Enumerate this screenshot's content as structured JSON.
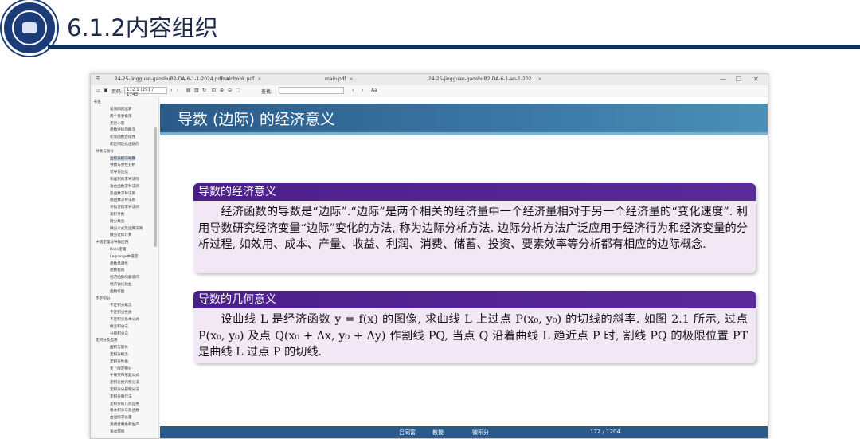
{
  "slide": {
    "title": "6.1.2内容组织"
  },
  "window": {
    "tabs": [
      {
        "label": "24-25-jingguan-gaoshuB2-DA-6-1-1-2024.pdf"
      },
      {
        "label": "mainbook.pdf"
      },
      {
        "label": "main.pdf"
      },
      {
        "label": "24-25-jingguan-gaoshuB2-DA-6-1-an-1-202.."
      }
    ],
    "controls": [
      "—",
      "☐",
      "✕"
    ],
    "toolbar": {
      "page_label": "页码:",
      "page_value": "172.1 (291 / 1743)",
      "search_label": "查找:",
      "aa": "Aa"
    }
  },
  "sidebar": {
    "title": "书签",
    "items": [
      {
        "label": "极限四则运算",
        "indent": 2
      },
      {
        "label": "两个重要极限",
        "indent": 2
      },
      {
        "label": "无穷小量",
        "indent": 2
      },
      {
        "label": "函数连续的概念",
        "indent": 2
      },
      {
        "label": "初等函数连续性",
        "indent": 2
      },
      {
        "label": "闭区间连续函数的",
        "indent": 2
      },
      {
        "label": "导数与微分",
        "indent": 1
      },
      {
        "label": "边际分析与导数",
        "indent": 2
      },
      {
        "label": "导数与弹性分析",
        "indent": 2
      },
      {
        "label": "可导与连续",
        "indent": 2
      },
      {
        "label": "和差积商求导法则",
        "indent": 2
      },
      {
        "label": "复合函数求导法则",
        "indent": 2
      },
      {
        "label": "反函数求导法则",
        "indent": 2
      },
      {
        "label": "隐函数求导法则",
        "indent": 2
      },
      {
        "label": "参数方程求导法则",
        "indent": 2
      },
      {
        "label": "高阶导数",
        "indent": 2
      },
      {
        "label": "微分概念",
        "indent": 2
      },
      {
        "label": "微分公式及运算法则",
        "indent": 2
      },
      {
        "label": "微分近似计算",
        "indent": 2
      },
      {
        "label": "中值定理与导数应用",
        "indent": 1
      },
      {
        "label": "Rolle定理",
        "indent": 2
      },
      {
        "label": "Lagrange中值定",
        "indent": 2
      },
      {
        "label": "函数单调性",
        "indent": 2
      },
      {
        "label": "函数极值",
        "indent": 2
      },
      {
        "label": "经济函数的最值问",
        "indent": 2
      },
      {
        "label": "经济优化效益",
        "indent": 2
      },
      {
        "label": "函数作图",
        "indent": 2
      },
      {
        "label": "不定积分",
        "indent": 1
      },
      {
        "label": "不定积分概念",
        "indent": 2
      },
      {
        "label": "不定积分性质",
        "indent": 2
      },
      {
        "label": "不定积分基本公式",
        "indent": 2
      },
      {
        "label": "换元积分法",
        "indent": 2
      },
      {
        "label": "分部积分法",
        "indent": 2
      },
      {
        "label": "定积分及应用",
        "indent": 1
      },
      {
        "label": "面积与旋体",
        "indent": 2
      },
      {
        "label": "定积分概念",
        "indent": 2
      },
      {
        "label": "定积分性质",
        "indent": 2
      },
      {
        "label": "变上限定积分",
        "indent": 2
      },
      {
        "label": "牛顿莱布尼兹公式",
        "indent": 2
      },
      {
        "label": "定积分换元积分法",
        "indent": 2
      },
      {
        "label": "定积分分部积分法",
        "indent": 2
      },
      {
        "label": "定积分微元法",
        "indent": 2
      },
      {
        "label": "定积分的几何应用",
        "indent": 2
      },
      {
        "label": "根本积分与反函数",
        "indent": 2
      },
      {
        "label": "由边际求总量",
        "indent": 2
      },
      {
        "label": "消费者剩余和生产",
        "indent": 2
      },
      {
        "label": "资本现值",
        "indent": 2
      }
    ]
  },
  "page": {
    "title": "导数 (边际) 的经济意义",
    "block1": {
      "title": "导数的经济意义",
      "body": "经济函数的导数是“边际”.“边际”是两个相关的经济量中一个经济量相对于另一个经济量的“变化速度”. 利用导数研究经济变量“边际”变化的方法, 称为边际分析方法. 边际分析方法广泛应用于经济行为和经济变量的分析过程, 如效用、成本、产量、收益、利润、消费、储蓄、投资、要素效率等分析都有相应的边际概念."
    },
    "block2": {
      "title": "导数的几何意义",
      "body": "设曲线 L 是经济函数 y = f(x) 的图像, 求曲线 L 上过点 P(x₀, y₀) 的切线的斜率. 如图 2.1 所示, 过点 P(x₀, y₀) 及点 Q(x₀ + Δx, y₀ + Δy) 作割线 PQ, 当点 Q 沿着曲线 L 趋近点 P 时, 割线 PQ 的极限位置 PT 是曲线 L 过点 P 的切线."
    },
    "footer": {
      "author": "吕同富",
      "role": "教授",
      "course": "微积分",
      "pagenum": "172 / 1204"
    }
  }
}
